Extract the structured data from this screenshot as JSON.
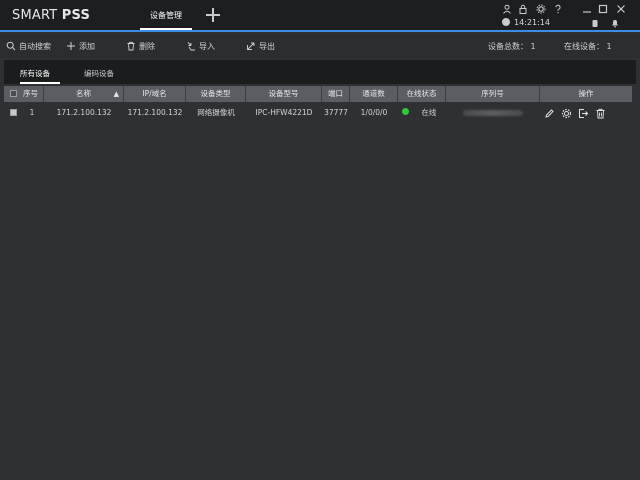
{
  "app": {
    "logo_light": "SMART",
    "logo_bold": "PSS"
  },
  "tabs": [
    {
      "label": "设备管理"
    }
  ],
  "clock": "14:21:14",
  "toolbar": {
    "auto_search": "自动搜索",
    "add": "添加",
    "delete": "删除",
    "import": "导入",
    "export": "导出",
    "device_total_label": "设备总数：",
    "device_total": "1",
    "online_label": "在线设备：",
    "online_count": "1"
  },
  "subtabs": {
    "all": "所有设备",
    "encoder": "编码设备"
  },
  "table": {
    "headers": {
      "index": "序号",
      "name": "名称",
      "ip": "IP/域名",
      "type": "设备类型",
      "model": "设备型号",
      "port": "端口",
      "channels": "通道数",
      "status": "在线状态",
      "serial": "序列号",
      "actions": "操作"
    },
    "rows": [
      {
        "index": "1",
        "name": "171.2.100.132",
        "ip": "171.2.100.132",
        "type": "网络摄像机",
        "model": "IPC-HFW4221D",
        "port": "37777",
        "channels": "1/0/0/0",
        "status": "在线"
      }
    ]
  },
  "colors": {
    "accent": "#3a8ee6",
    "online": "#34c73b",
    "header_bg": "#5a5d62"
  },
  "icons": [
    "user-icon",
    "lock-icon",
    "settings-icon",
    "help-icon",
    "minimize-icon",
    "maximize-icon",
    "close-icon",
    "clock-icon",
    "bell-icon",
    "edit-icon",
    "gear-icon",
    "login-icon",
    "trash-icon"
  ]
}
